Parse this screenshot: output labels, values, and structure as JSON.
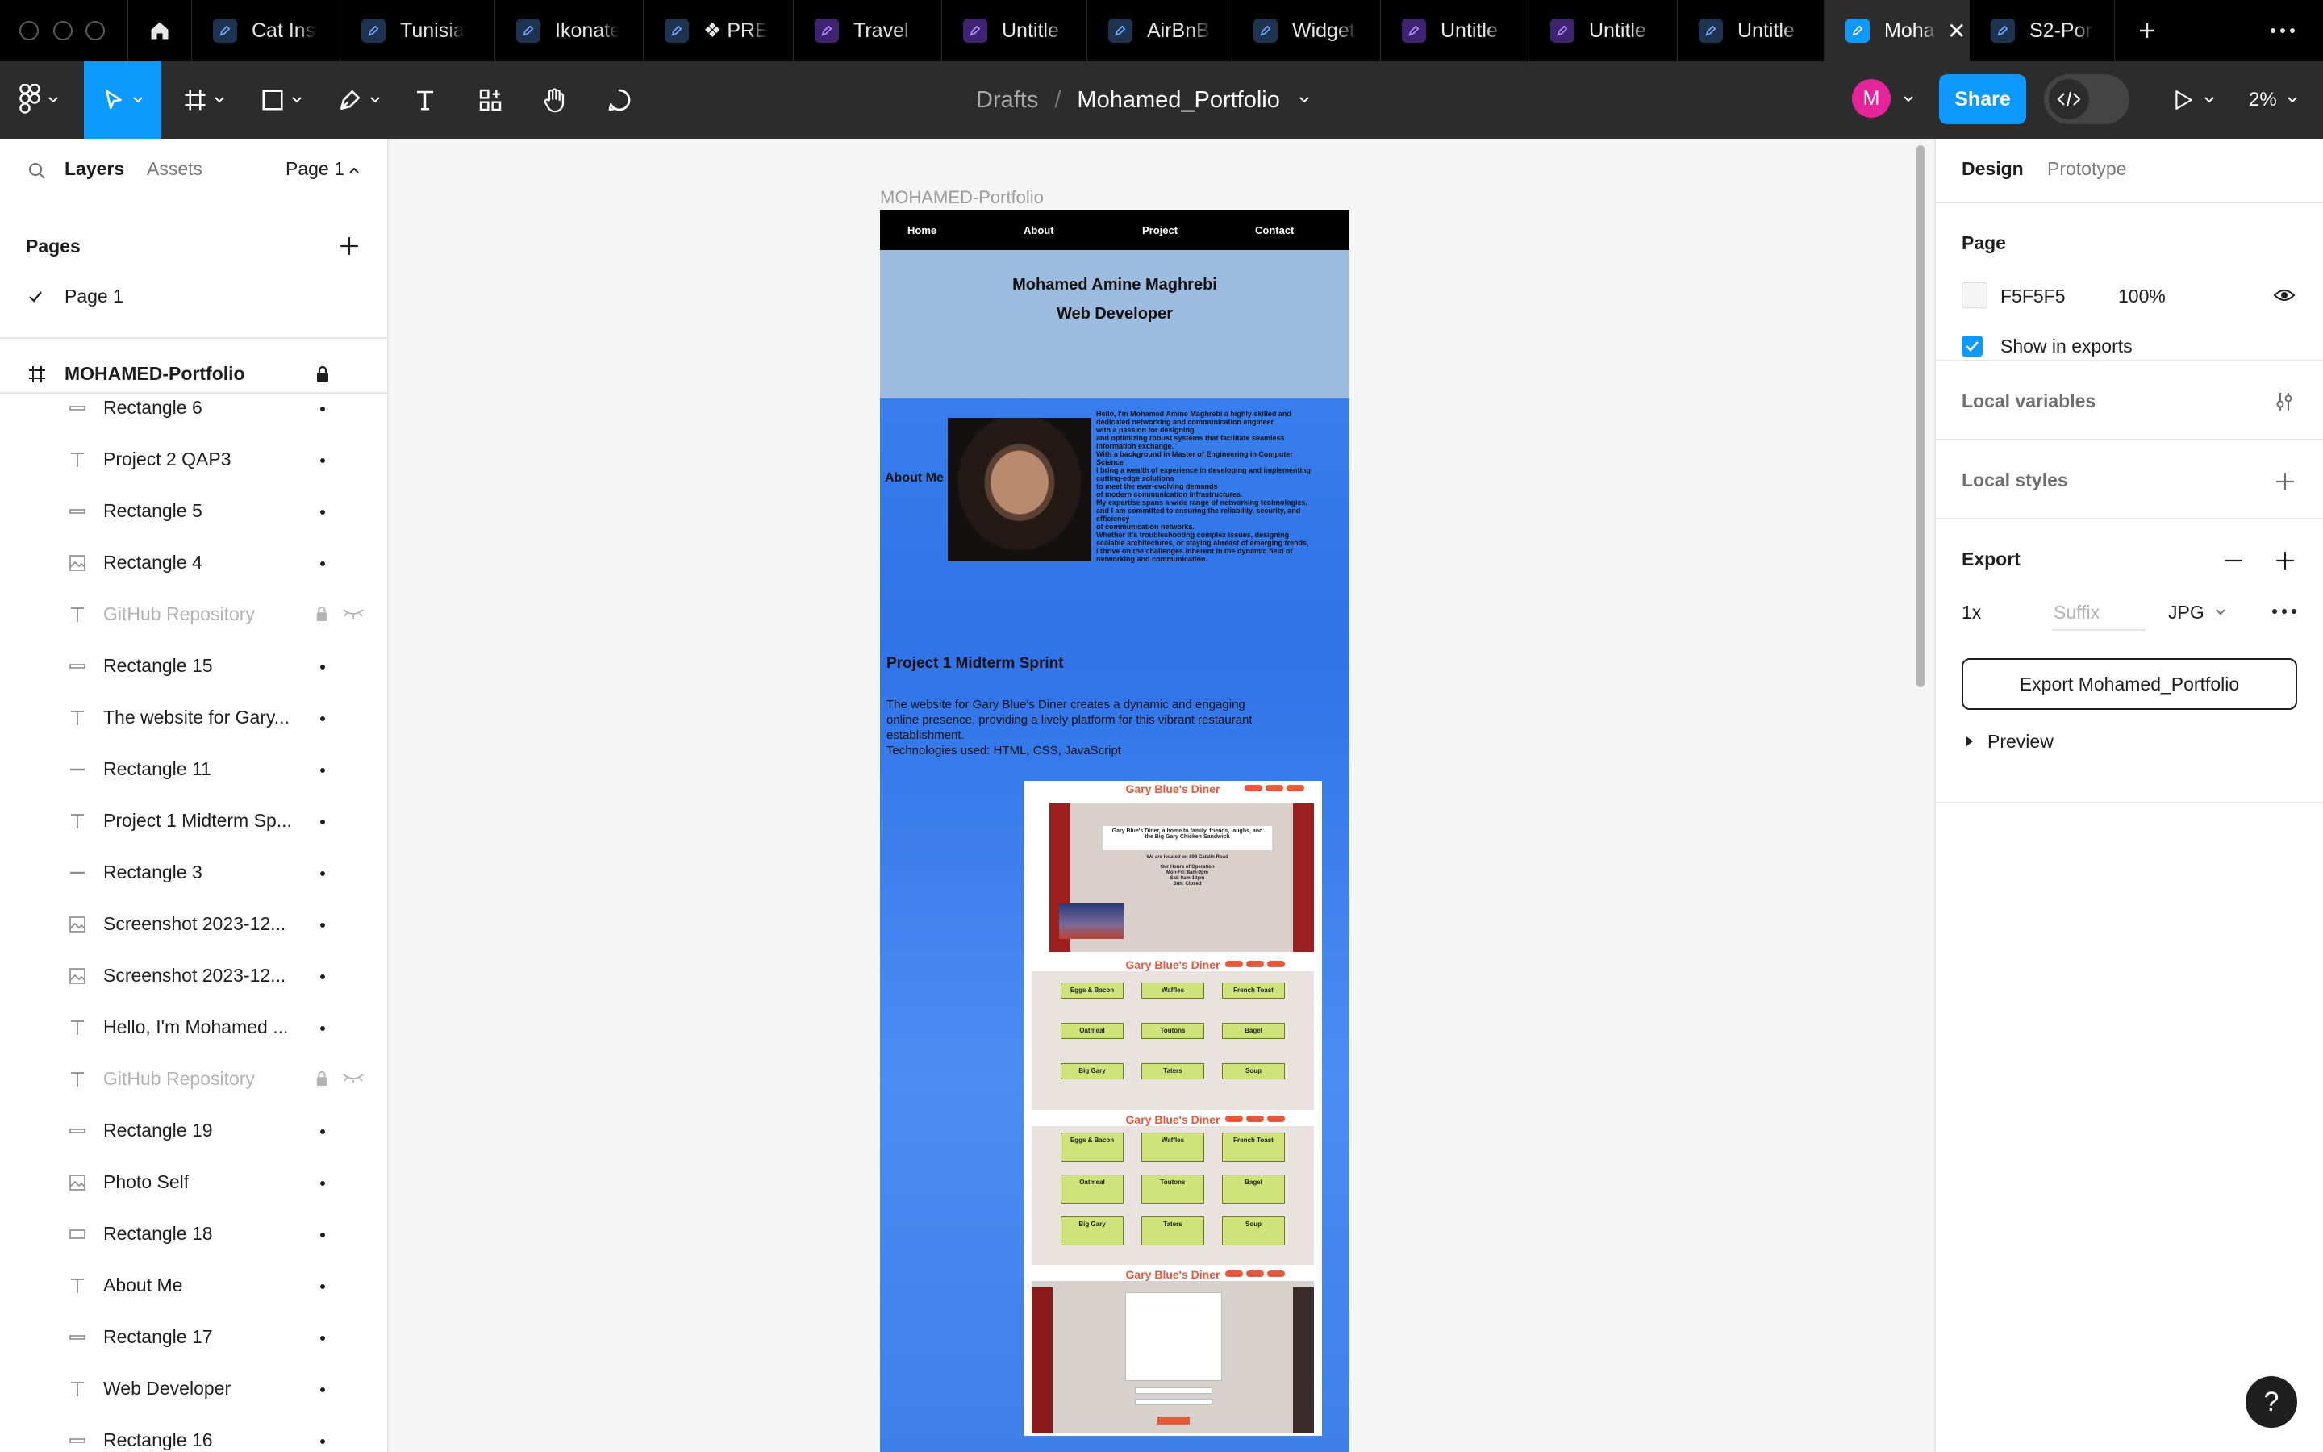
{
  "tabs": [
    {
      "label": "Cat Ins",
      "icon": "figma-file-icon"
    },
    {
      "label": "Tunisia",
      "icon": "figma-file-icon"
    },
    {
      "label": "Ikonate",
      "icon": "figma-file-icon"
    },
    {
      "label": "❖ PRE",
      "icon": "figma-file-icon"
    },
    {
      "label": "Travel",
      "icon": "figjam-file-icon"
    },
    {
      "label": "Untitle",
      "icon": "figjam-file-icon"
    },
    {
      "label": "AirBnB",
      "icon": "figma-file-icon"
    },
    {
      "label": "Widget",
      "icon": "figma-file-icon"
    },
    {
      "label": "Untitle",
      "icon": "figjam-file-icon"
    },
    {
      "label": "Untitle",
      "icon": "figjam-file-icon"
    },
    {
      "label": "Untitle",
      "icon": "figma-file-icon"
    },
    {
      "label": "Moha",
      "icon": "figma-file-icon",
      "active": true
    },
    {
      "label": "S2-Por",
      "icon": "figma-file-icon"
    }
  ],
  "breadcrumb": {
    "parent": "Drafts",
    "separator": "/",
    "file": "Mohamed_Portfolio"
  },
  "user": {
    "avatar_letter": "M",
    "avatar_color": "#e5249a"
  },
  "share_label": "Share",
  "zoom": "2%",
  "accent": "#0d99ff",
  "left_panel": {
    "tabs": {
      "layers": "Layers",
      "assets": "Assets",
      "page_selector": "Page 1"
    },
    "pages_title": "Pages",
    "pages": [
      {
        "name": "Page 1",
        "current": true
      }
    ],
    "frame": {
      "name": "MOHAMED-Portfolio",
      "locked": true
    },
    "layers": [
      {
        "name": "Rectangle 6",
        "icon": "rectangle-line"
      },
      {
        "name": "Project 2 QAP3",
        "icon": "text"
      },
      {
        "name": "Rectangle 5",
        "icon": "rectangle-line"
      },
      {
        "name": "Rectangle 4",
        "icon": "image"
      },
      {
        "name": "GitHub Repository",
        "icon": "text",
        "hidden": true,
        "locked": true
      },
      {
        "name": "Rectangle 15",
        "icon": "rectangle-line"
      },
      {
        "name": "The website for Gary...",
        "icon": "text"
      },
      {
        "name": "Rectangle 11",
        "icon": "line"
      },
      {
        "name": "Project 1 Midterm Sp...",
        "icon": "text"
      },
      {
        "name": "Rectangle 3",
        "icon": "line"
      },
      {
        "name": "Screenshot 2023-12...",
        "icon": "image"
      },
      {
        "name": "Screenshot 2023-12...",
        "icon": "image"
      },
      {
        "name": "Hello, I'm Mohamed ...",
        "icon": "text"
      },
      {
        "name": "GitHub Repository",
        "icon": "text",
        "hidden": true,
        "locked": true
      },
      {
        "name": "Rectangle 19",
        "icon": "rectangle-line"
      },
      {
        "name": "Photo Self",
        "icon": "image"
      },
      {
        "name": "Rectangle 18",
        "icon": "rectangle"
      },
      {
        "name": "About Me",
        "icon": "text"
      },
      {
        "name": "Rectangle 17",
        "icon": "rectangle-line"
      },
      {
        "name": "Web Developer",
        "icon": "text"
      },
      {
        "name": "Rectangle 16",
        "icon": "rectangle-line"
      }
    ]
  },
  "canvas": {
    "frame_label": "MOHAMED-Portfolio",
    "nav": [
      "Home",
      "About",
      "Project",
      "Contact"
    ],
    "hero_name": "Mohamed Amine Maghrebi",
    "hero_role": "Web Developer",
    "about_label": "About Me",
    "bio": "Hello, I'm Mohamed Amine Maghrebi a highly skilled and\ndedicated networking and communication engineer\nwith a passion for designing\nand optimizing robust systems that facilitate seamless\ninformation exchange.\n With a background in Master of Engineering in Computer\nScience\nI bring a wealth of experience in developing and implementing\ncutting-edge solutions\n to meet the ever-evolving demands\nof modern communication infrastructures.\nMy expertise spans a wide range of networking technologies,\nand I am committed to ensuring the reliability, security, and\nefficiency\nof communication networks.\nWhether it's troubleshooting complex issues, designing\nscalable architectures, or staying abreast of emerging trends,\nI thrive on the challenges inherent in the dynamic field of\nnetworking and communication.",
    "project_title": "Project 1 Midterm Sprint",
    "project_desc": "The website for Gary Blue's Diner creates a dynamic and engaging\n online presence, providing a lively platform for this vibrant restaurant\nestablishment.\nTechnologies used: HTML, CSS, JavaScript",
    "diner_title": "Gary Blue's Diner",
    "diner_card_title": "Gary Blue's Diner, a home to family, friends, laughs, and\nthe Big Gary Chicken Sandwich",
    "diner_address": "We are located on 898 Catalin Road",
    "diner_hours": "Our Hours of Operation\nMon-Fri: 8am-9pm\nSat: 9am-10pm\nSun: Closed",
    "menu_items": [
      "Eggs & Bacon",
      "Waffles",
      "French Toast",
      "Oatmeal",
      "Toutons",
      "Bagel",
      "Big Gary",
      "Taters",
      "Soup"
    ]
  },
  "right_panel": {
    "tabs": {
      "design": "Design",
      "prototype": "Prototype"
    },
    "page_title": "Page",
    "page_color_hex": "F5F5F5",
    "page_color": "#F5F5F5",
    "page_opacity": "100%",
    "show_in_exports": "Show in exports",
    "show_in_exports_checked": true,
    "local_variables": "Local variables",
    "local_styles": "Local styles",
    "export_title": "Export",
    "export_scale": "1x",
    "export_suffix_placeholder": "Suffix",
    "export_format": "JPG",
    "export_button": "Export Mohamed_Portfolio",
    "preview": "Preview"
  },
  "help_label": "?"
}
